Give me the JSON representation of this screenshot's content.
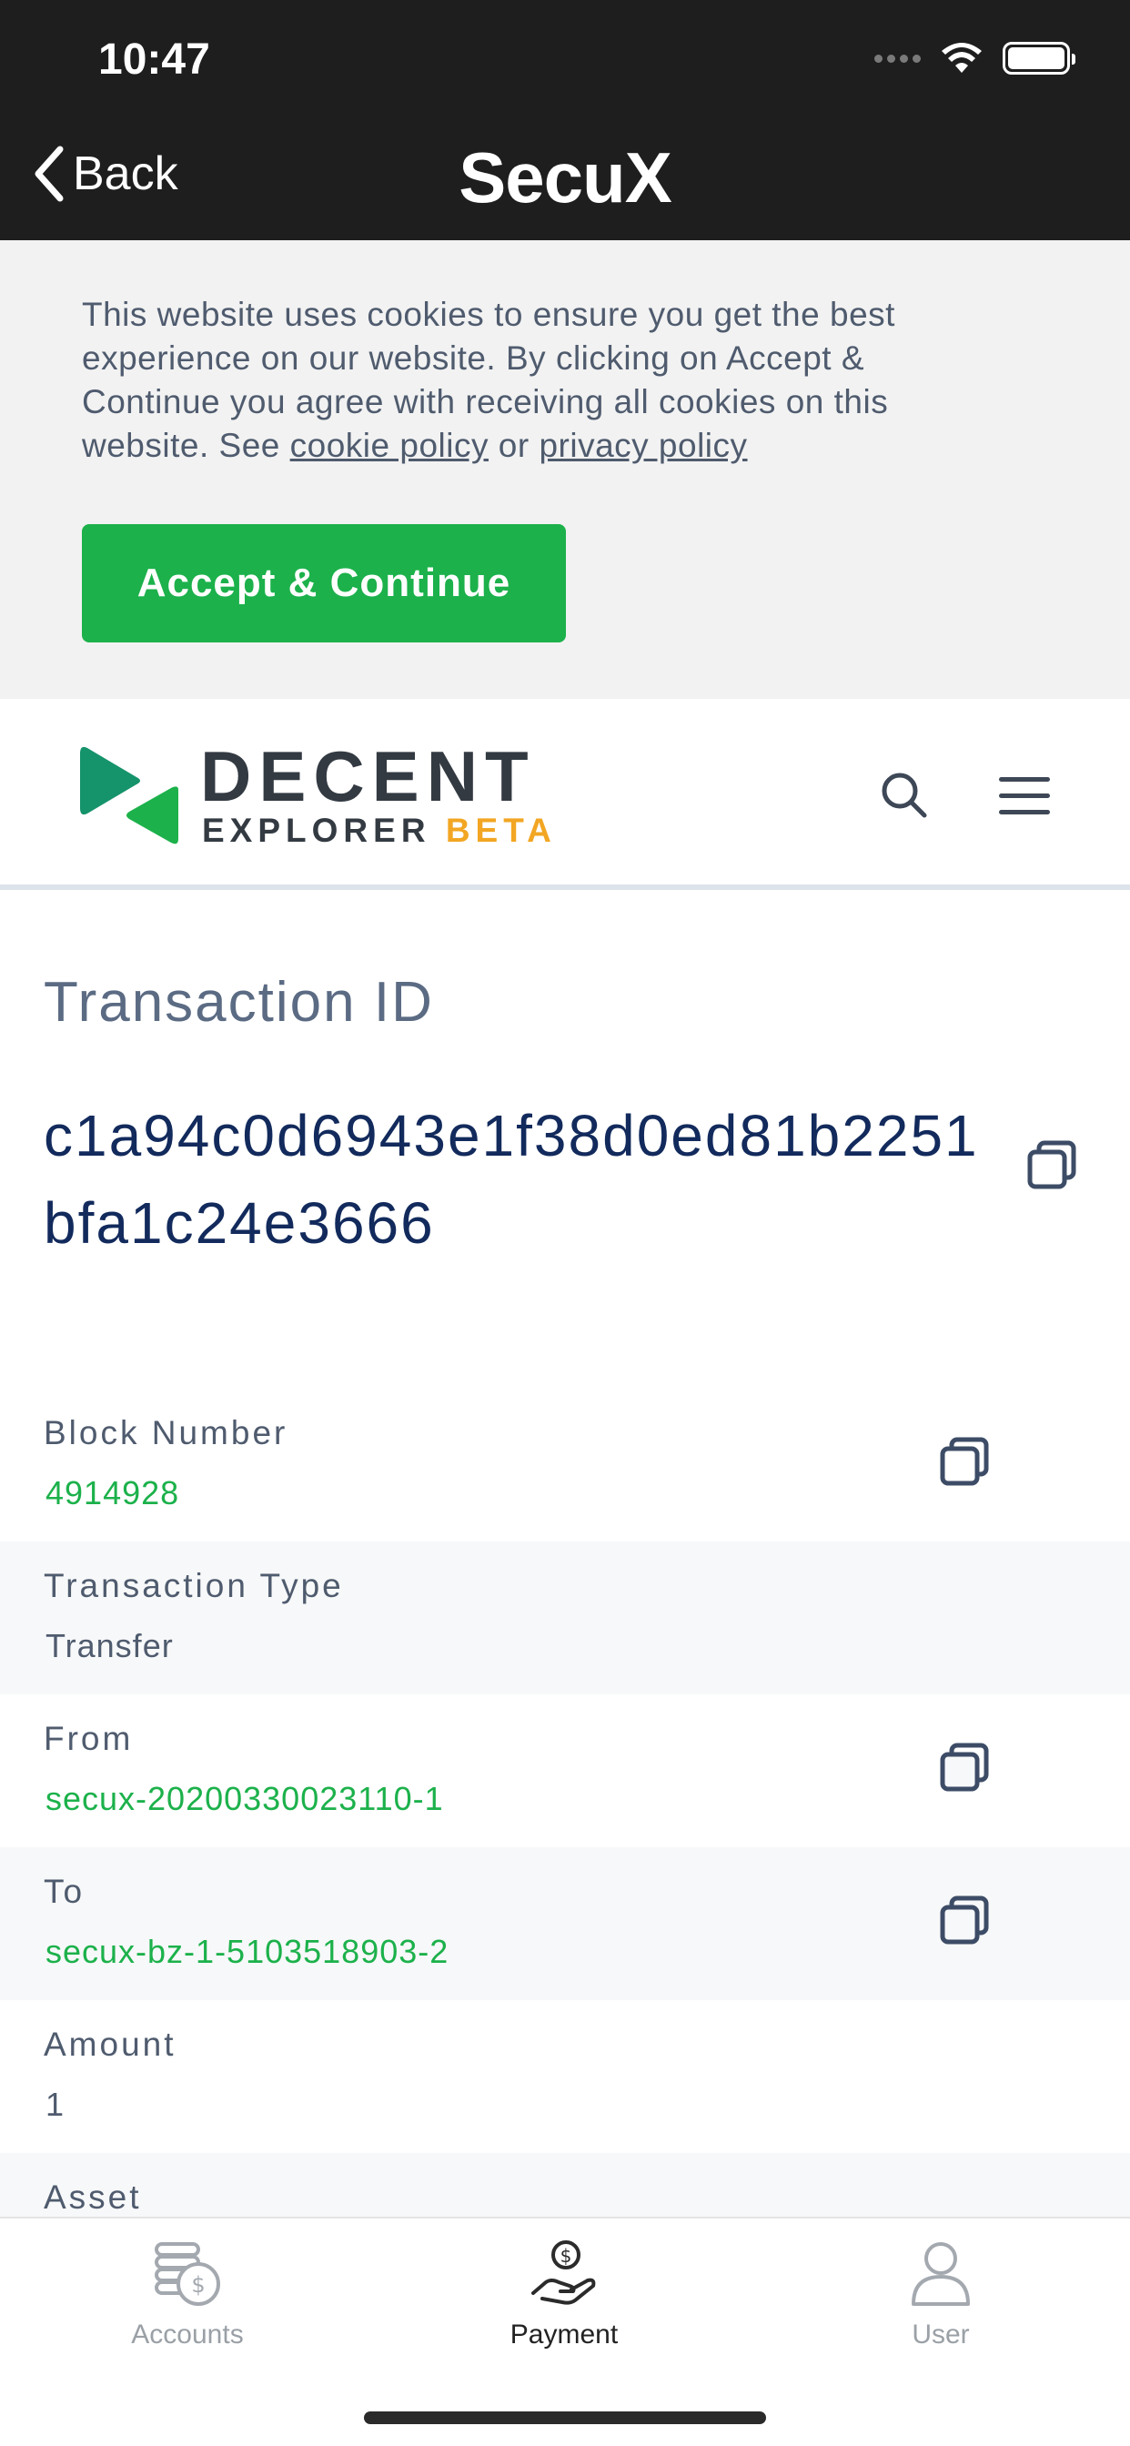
{
  "status_bar": {
    "time": "10:47"
  },
  "nav": {
    "back_label": "Back",
    "brand": "SecuX"
  },
  "cookie_banner": {
    "text_before": "This website uses cookies to ensure you get the best experience on our website. By clicking on Accept & Continue you agree with receiving all cookies on this website. See ",
    "cookie_policy_link": "cookie policy",
    "text_or": " or ",
    "privacy_policy_link": "privacy policy",
    "accept_button": "Accept & Continue"
  },
  "explorer": {
    "logo_title": "DECENT",
    "logo_sub": "EXPLORER",
    "logo_beta": "BETA"
  },
  "transaction": {
    "title": "Transaction ID",
    "id": "c1a94c0d6943e1f38d0ed81b2251bfa1c24e3666",
    "fields": [
      {
        "label": "Block Number",
        "value": "4914928"
      },
      {
        "label": "Transaction Type",
        "value": "Transfer"
      },
      {
        "label": "From",
        "value": "secux-20200330023110-1"
      },
      {
        "label": "To",
        "value": "secux-bz-1-5103518903-2"
      },
      {
        "label": "Amount",
        "value": "1"
      },
      {
        "label": "Asset",
        "value": ""
      }
    ]
  },
  "tabbar": {
    "tabs": [
      {
        "label": "Accounts"
      },
      {
        "label": "Payment"
      },
      {
        "label": "User"
      }
    ]
  },
  "colors": {
    "accent_green": "#1cb14b",
    "beta_orange": "#f2a623",
    "header_dark": "#1e1e1e",
    "tx_id_navy": "#122a5c"
  }
}
